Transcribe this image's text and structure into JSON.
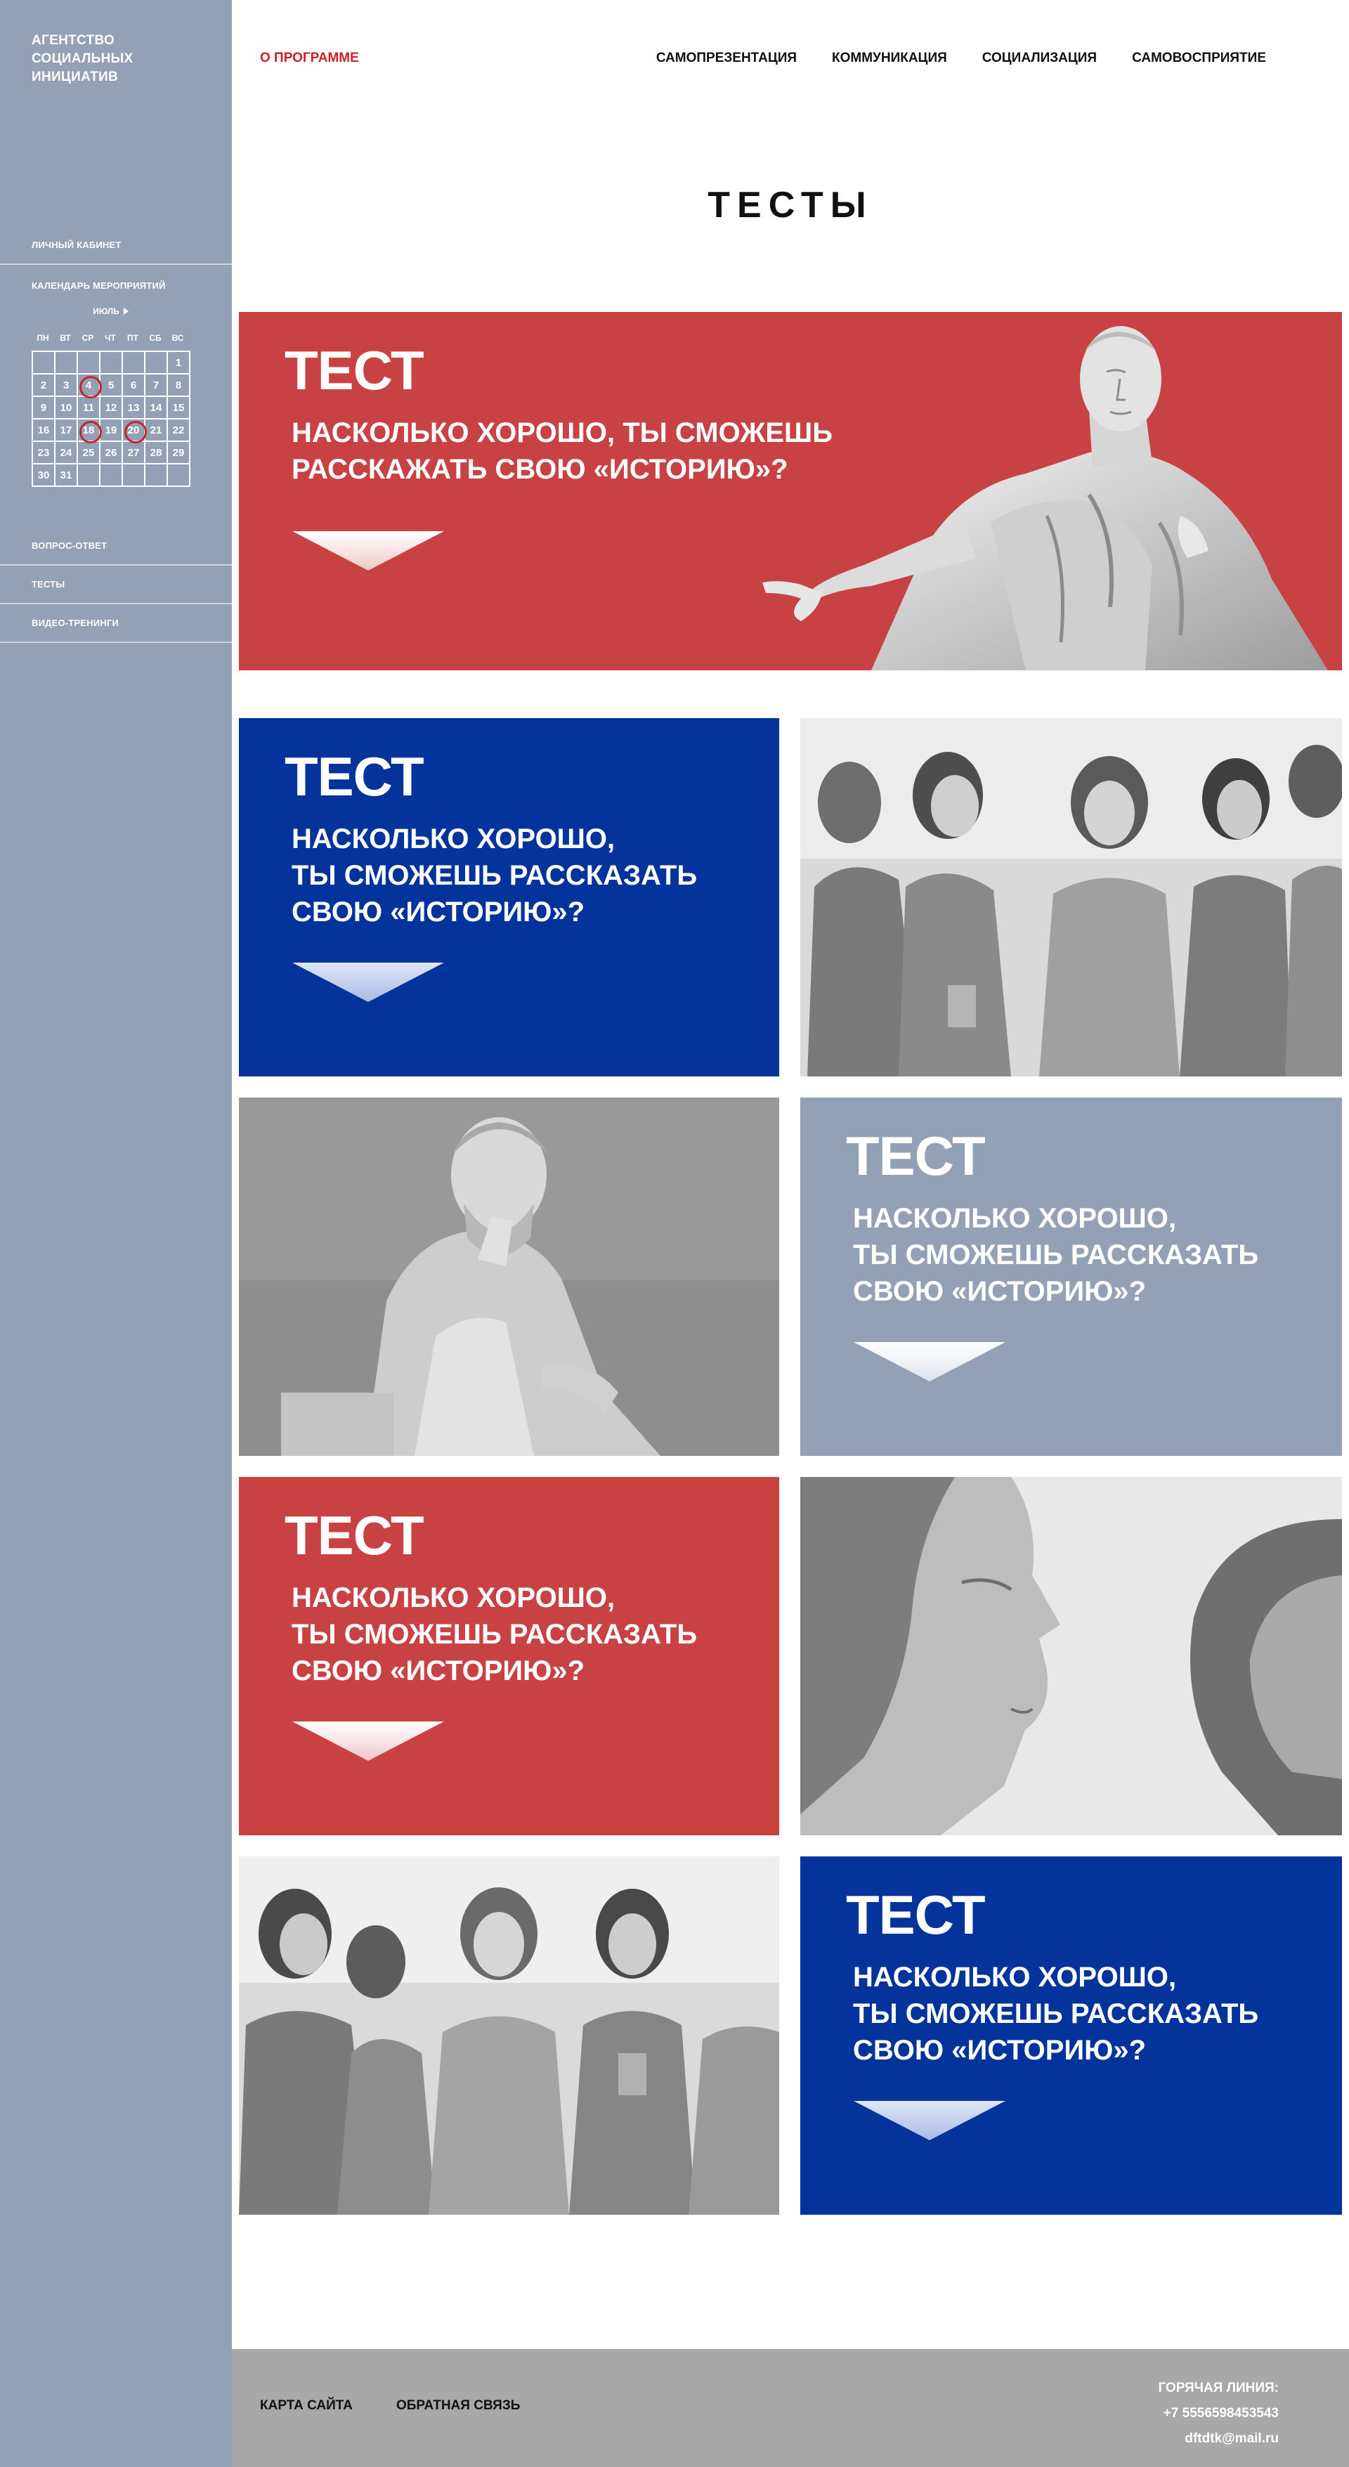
{
  "sidebar": {
    "brand": "АГЕНТСТВО СОЦИАЛЬНЫХ ИНИЦИАТИВ",
    "account": "ЛИЧНЫЙ КАБИНЕТ",
    "calendar_label": "КАЛЕНДАРЬ МЕРОПРИЯТИЙ",
    "calendar": {
      "month": "ИЮЛЬ",
      "weekdays": [
        "ПН",
        "ВТ",
        "СР",
        "ЧТ",
        "ПТ",
        "СБ",
        "ВС"
      ],
      "days": [
        "",
        "",
        "",
        "",
        "",
        "",
        "1",
        "2",
        "3",
        "4",
        "5",
        "6",
        "7",
        "8",
        "9",
        "10",
        "11",
        "12",
        "13",
        "14",
        "15",
        "16",
        "17",
        "18",
        "19",
        "20",
        "21",
        "22",
        "23",
        "24",
        "25",
        "26",
        "27",
        "28",
        "29",
        "30",
        "31",
        "",
        "",
        "",
        "",
        ""
      ],
      "marked": [
        "4",
        "18",
        "20"
      ]
    },
    "faq": "ВОПРОС-ОТВЕТ",
    "tests": "ТЕСТЫ",
    "video": "ВИДЕО-ТРЕНИНГИ"
  },
  "nav": {
    "about": "О ПРОГРАММЕ",
    "items": [
      "САМОПРЕЗЕНТАЦИЯ",
      "КОММУНИКАЦИЯ",
      "СОЦИАЛИЗАЦИЯ",
      "САМОВОСПРИЯТИЕ"
    ]
  },
  "page_title": "ТЕСТЫ",
  "tests": [
    {
      "tag": "ТЕСТ",
      "q1": "НАСКОЛЬКО ХОРОШО, ТЫ СМОЖЕШЬ",
      "q2": "РАССКАЖАТЬ СВОЮ «ИСТОРИЮ»?",
      "q3": ""
    },
    {
      "tag": "ТЕСТ",
      "q1": "НАСКОЛЬКО ХОРОШО,",
      "q2": "ТЫ СМОЖЕШЬ РАССКАЗАТЬ",
      "q3": "СВОЮ «ИСТОРИЮ»?"
    },
    {
      "tag": "ТЕСТ",
      "q1": "НАСКОЛЬКО ХОРОШО,",
      "q2": "ТЫ СМОЖЕШЬ РАССКАЗАТЬ",
      "q3": "СВОЮ «ИСТОРИЮ»?"
    },
    {
      "tag": "ТЕСТ",
      "q1": "НАСКОЛЬКО ХОРОШО,",
      "q2": "ТЫ СМОЖЕШЬ РАССКАЗАТЬ",
      "q3": "СВОЮ «ИСТОРИЮ»?"
    },
    {
      "tag": "ТЕСТ",
      "q1": "НАСКОЛЬКО ХОРОШО,",
      "q2": "ТЫ СМОЖЕШЬ РАССКАЗАТЬ",
      "q3": "СВОЮ «ИСТОРИЮ»?"
    }
  ],
  "footer": {
    "sitemap": "КАРТА САЙТА",
    "feedback": "ОБРАТНАЯ СВЯЗЬ",
    "hotline": "ГОРЯЧАЯ ЛИНИЯ:",
    "phone": "+7 5556598453543",
    "email": "dftdtk@mail.ru"
  },
  "colors": {
    "red": "#c84143",
    "blue": "#03339b",
    "grey_blue": "#93a1b7",
    "accent": "#d01f2a",
    "footer": "#a8a8a8"
  }
}
